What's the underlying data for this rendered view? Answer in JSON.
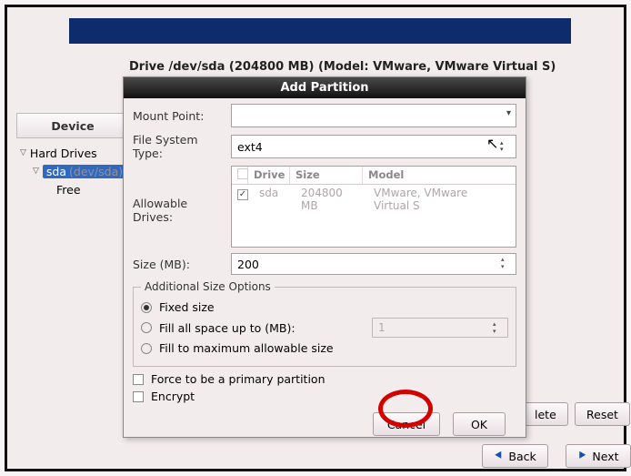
{
  "drive_line": "Drive /dev/sda (204800 MB) (Model: VMware, VMware Virtual S)",
  "left": {
    "header": "Device",
    "root": "Hard Drives",
    "sel": "sda",
    "sel_suffix": "(dev/sda)",
    "free": "Free"
  },
  "dialog": {
    "title": "Add Partition",
    "mount_label": "Mount Point:",
    "mount_value": "",
    "fs_label": "File System Type:",
    "fs_value": "ext4",
    "allow_label": "Allowable Drives:",
    "drv_cols": {
      "c0": "",
      "c1": "Drive",
      "c2": "Size",
      "c3": "Model"
    },
    "drv_row": {
      "name": "sda",
      "size": "204800 MB",
      "model": "VMware, VMware Virtual S"
    },
    "size_label": "Size (MB):",
    "size_value": "200",
    "aso_legend": "Additional Size Options",
    "r_fixed": "Fixed size",
    "r_fill_up": "Fill all space up to (MB):",
    "fill_up_val": "1",
    "r_fill_max": "Fill to maximum allowable size",
    "chk_primary": "Force to be a primary partition",
    "chk_encrypt": "Encrypt",
    "btn_cancel": "Cancel",
    "btn_ok": "OK"
  },
  "bg": {
    "delete_vis": "lete",
    "reset": "Reset",
    "back": "Back",
    "next": "Next"
  }
}
